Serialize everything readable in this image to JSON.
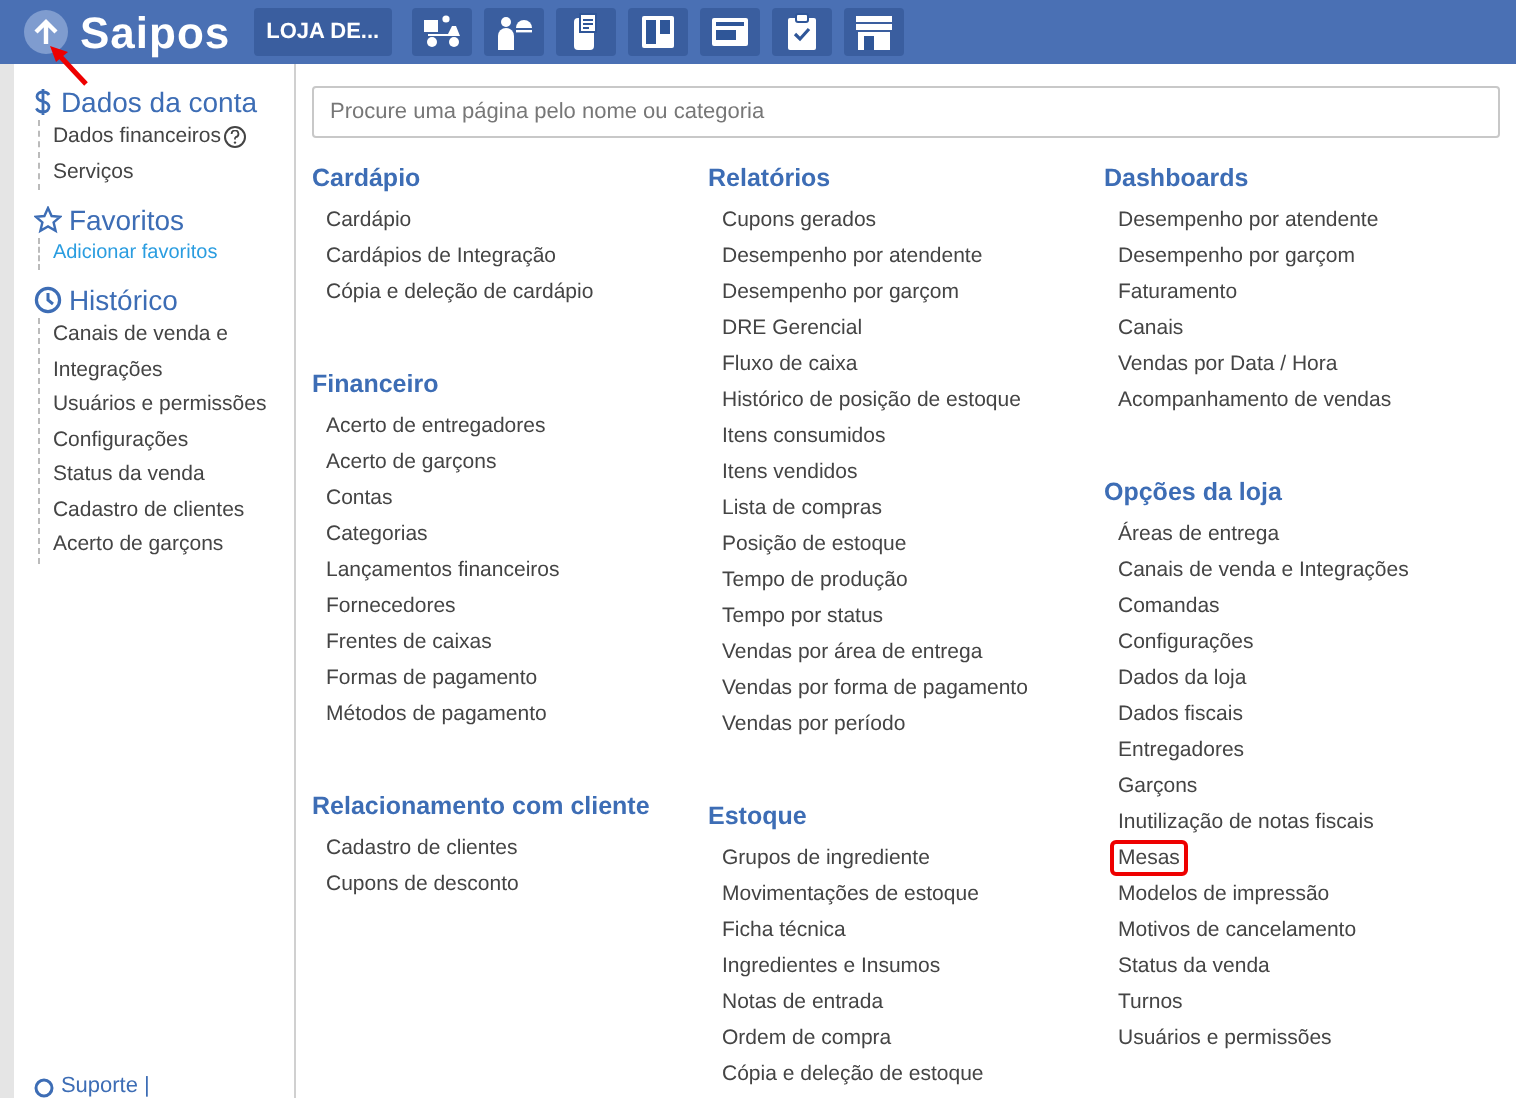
{
  "header": {
    "logo": "Saipos",
    "store_button": "LOJA DE...",
    "toolbar": [
      {
        "kind": "delivery"
      },
      {
        "kind": "waiter"
      },
      {
        "kind": "receipt"
      },
      {
        "kind": "board"
      },
      {
        "kind": "panel"
      },
      {
        "kind": "clipboard"
      },
      {
        "kind": "store"
      }
    ]
  },
  "sidebar": {
    "sections": [
      {
        "kind": "account",
        "title": "Dados da conta",
        "items": [
          {
            "label": "Dados financeiros",
            "help": true
          },
          {
            "label": "Serviços",
            "help": false
          }
        ]
      },
      {
        "kind": "favorites",
        "title": "Favoritos",
        "link": "Adicionar favoritos"
      },
      {
        "kind": "history",
        "title": "Histórico",
        "items": [
          {
            "label": "Canais de venda e Integrações",
            "help": false
          },
          {
            "label": "Usuários e permissões",
            "help": false
          },
          {
            "label": "Configurações",
            "help": false
          },
          {
            "label": "Status da venda",
            "help": false
          },
          {
            "label": "Cadastro de clientes",
            "help": false
          },
          {
            "label": "Acerto de garçons",
            "help": false
          }
        ]
      }
    ],
    "footer": "Suporte |"
  },
  "search": {
    "placeholder": "Procure uma página pelo nome ou categoria"
  },
  "columns": [
    [
      {
        "title": "Cardápio",
        "items": [
          {
            "label": "Cardápio",
            "highlighted": false
          },
          {
            "label": "Cardápios de Integração",
            "highlighted": false
          },
          {
            "label": "Cópia e deleção de cardápio",
            "highlighted": false
          }
        ]
      },
      {
        "title": "Financeiro",
        "items": [
          {
            "label": "Acerto de entregadores",
            "highlighted": false
          },
          {
            "label": "Acerto de garçons",
            "highlighted": false
          },
          {
            "label": "Contas",
            "highlighted": false
          },
          {
            "label": "Categorias",
            "highlighted": false
          },
          {
            "label": "Lançamentos financeiros",
            "highlighted": false
          },
          {
            "label": "Fornecedores",
            "highlighted": false
          },
          {
            "label": "Frentes de caixas",
            "highlighted": false
          },
          {
            "label": "Formas de pagamento",
            "highlighted": false
          },
          {
            "label": "Métodos de pagamento",
            "highlighted": false
          }
        ]
      },
      {
        "title": "Relacionamento com cliente",
        "items": [
          {
            "label": "Cadastro de clientes",
            "highlighted": false
          },
          {
            "label": "Cupons de desconto",
            "highlighted": false
          }
        ]
      }
    ],
    [
      {
        "title": "Relatórios",
        "items": [
          {
            "label": "Cupons gerados",
            "highlighted": false
          },
          {
            "label": "Desempenho por atendente",
            "highlighted": false
          },
          {
            "label": "Desempenho por garçom",
            "highlighted": false
          },
          {
            "label": "DRE Gerencial",
            "highlighted": false
          },
          {
            "label": "Fluxo de caixa",
            "highlighted": false
          },
          {
            "label": "Histórico de posição de estoque",
            "highlighted": false
          },
          {
            "label": "Itens consumidos",
            "highlighted": false
          },
          {
            "label": "Itens vendidos",
            "highlighted": false
          },
          {
            "label": "Lista de compras",
            "highlighted": false
          },
          {
            "label": "Posição de estoque",
            "highlighted": false
          },
          {
            "label": "Tempo de produção",
            "highlighted": false
          },
          {
            "label": "Tempo por status",
            "highlighted": false
          },
          {
            "label": "Vendas por área de entrega",
            "highlighted": false
          },
          {
            "label": "Vendas por forma de pagamento",
            "highlighted": false
          },
          {
            "label": "Vendas por período",
            "highlighted": false
          }
        ]
      },
      {
        "title": "Estoque",
        "items": [
          {
            "label": "Grupos de ingrediente",
            "highlighted": false
          },
          {
            "label": "Movimentações de estoque",
            "highlighted": false
          },
          {
            "label": "Ficha técnica",
            "highlighted": false
          },
          {
            "label": "Ingredientes e Insumos",
            "highlighted": false
          },
          {
            "label": "Notas de entrada",
            "highlighted": false
          },
          {
            "label": "Ordem de compra",
            "highlighted": false
          },
          {
            "label": "Cópia e deleção de estoque",
            "highlighted": false
          }
        ]
      }
    ],
    [
      {
        "title": "Dashboards",
        "items": [
          {
            "label": "Desempenho por atendente",
            "highlighted": false
          },
          {
            "label": "Desempenho por garçom",
            "highlighted": false
          },
          {
            "label": "Faturamento",
            "highlighted": false
          },
          {
            "label": "Canais",
            "highlighted": false
          },
          {
            "label": "Vendas por Data / Hora",
            "highlighted": false
          },
          {
            "label": "Acompanhamento de vendas",
            "highlighted": false
          }
        ]
      },
      {
        "title": "Opções da loja",
        "items": [
          {
            "label": "Áreas de entrega",
            "highlighted": false
          },
          {
            "label": "Canais de venda e Integrações",
            "highlighted": false
          },
          {
            "label": "Comandas",
            "highlighted": false
          },
          {
            "label": "Configurações",
            "highlighted": false
          },
          {
            "label": "Dados da loja",
            "highlighted": false
          },
          {
            "label": "Dados fiscais",
            "highlighted": false
          },
          {
            "label": "Entregadores",
            "highlighted": false
          },
          {
            "label": "Garçons",
            "highlighted": false
          },
          {
            "label": "Inutilização de notas fiscais",
            "highlighted": false
          },
          {
            "label": "Mesas",
            "highlighted": true
          },
          {
            "label": "Modelos de impressão",
            "highlighted": false
          },
          {
            "label": "Motivos de cancelamento",
            "highlighted": false
          },
          {
            "label": "Status da venda",
            "highlighted": false
          },
          {
            "label": "Turnos",
            "highlighted": false
          },
          {
            "label": "Usuários e permissões",
            "highlighted": false
          }
        ]
      }
    ]
  ],
  "annotation_arrow": true
}
